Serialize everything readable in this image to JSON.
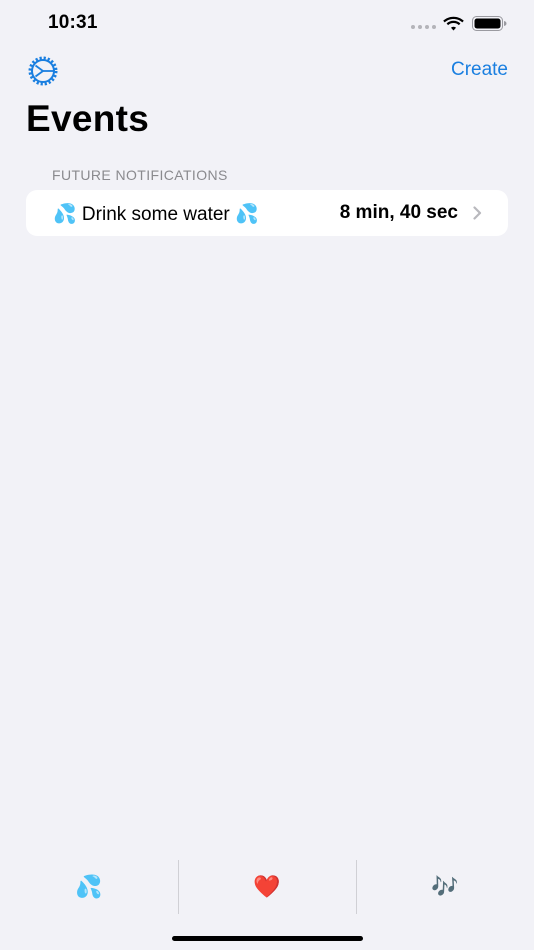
{
  "status_bar": {
    "time": "10:31",
    "wifi_icon": "wifi-icon",
    "battery_icon": "battery-icon"
  },
  "nav": {
    "settings_icon": "gear-icon",
    "create_label": "Create",
    "title": "Events"
  },
  "events": {
    "section_header": "FUTURE NOTIFICATIONS",
    "items": [
      {
        "name": "💦 Drink some water 💦",
        "time_remaining": "8 min, 40 sec"
      }
    ]
  },
  "tab_bar": {
    "tabs": [
      {
        "label": "💦"
      },
      {
        "label": "❤️"
      },
      {
        "label": "🎶"
      }
    ]
  },
  "colors": {
    "accent": "#1a7fe0",
    "background": "#f2f2f7",
    "section_header": "#8a8a8e"
  }
}
